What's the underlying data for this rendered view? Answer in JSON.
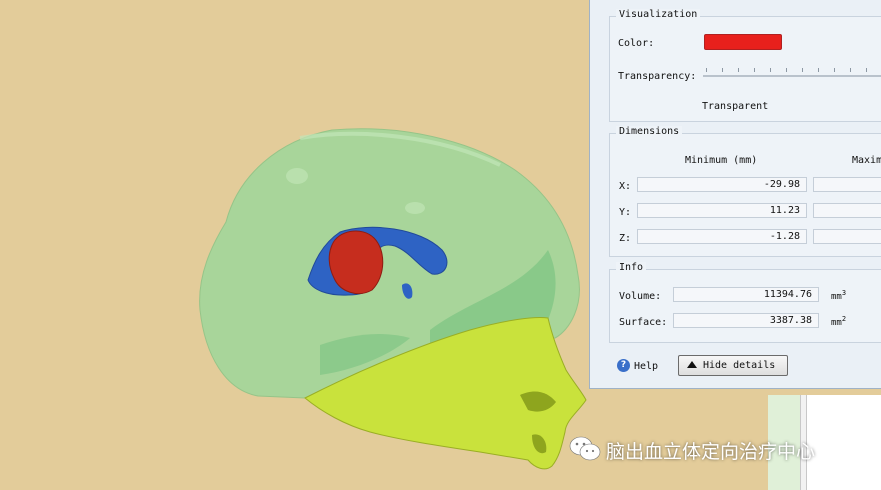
{
  "visualization": {
    "legend": "Visualization",
    "color_label": "Color:",
    "color_value": "#e8201c",
    "transparency_label": "Transparency:",
    "transparency_text": "Transparent",
    "transparency_level": 0
  },
  "dimensions": {
    "legend": "Dimensions",
    "col_min": "Minimum (mm)",
    "col_max": "Maxim",
    "rows": [
      {
        "axis": "X:",
        "min": "-29.98",
        "max": ""
      },
      {
        "axis": "Y:",
        "min": "11.23",
        "max": ""
      },
      {
        "axis": "Z:",
        "min": "-1.28",
        "max": ""
      }
    ]
  },
  "info": {
    "legend": "Info",
    "volume_label": "Volume:",
    "volume_value": "11394.76",
    "volume_unit": "mm",
    "volume_unit_sup": "3",
    "surface_label": "Surface:",
    "surface_value": "3387.38",
    "surface_unit": "mm",
    "surface_unit_sup": "2"
  },
  "footer": {
    "help_label": "Help",
    "help_icon": "?",
    "hide_details_label": "Hide details"
  },
  "watermark": {
    "icon": "wechat-icon",
    "text": "脑出血立体定向治疗中心"
  },
  "colors": {
    "background": "#e3cc9a",
    "skull": "#a6d69a",
    "face": "#c9e23c",
    "hematoma": "#c62d1e",
    "ventricle": "#2e63c4"
  }
}
